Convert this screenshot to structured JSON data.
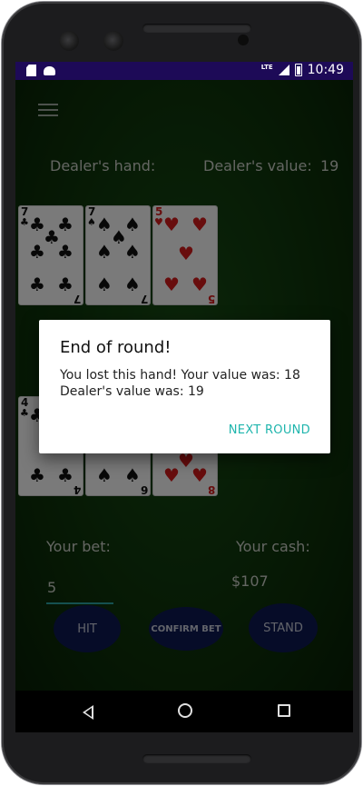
{
  "status_bar": {
    "network": "LTE",
    "time": "10:49"
  },
  "table": {
    "dealer_hand_label": "Dealer's hand:",
    "dealer_value_label": "Dealer's value:",
    "dealer_value": "19",
    "dealer_cards": [
      {
        "rank": "7",
        "suit": "♣"
      },
      {
        "rank": "7",
        "suit": "♠"
      },
      {
        "rank": "5",
        "suit": "♥"
      }
    ],
    "player_cards": [
      {
        "rank": "4",
        "suit": "♣"
      },
      {
        "rank": "6",
        "suit": "♠"
      },
      {
        "rank": "8",
        "suit": "♥"
      }
    ],
    "bet_label": "Your bet:",
    "bet_value": "5",
    "cash_label": "Your cash:",
    "cash_value": "$107",
    "hit_button": "HIT",
    "confirm_bet_button": "CONFIRM BET",
    "stand_button": "STAND"
  },
  "dialog": {
    "title": "End of round!",
    "message": "You lost this hand! Your value was: 18\nDealer's value was: 19",
    "next_button": "NEXT ROUND"
  },
  "colors": {
    "status_bar": "#1d0a57",
    "table_felt": "#174a14",
    "button": "#0c1850",
    "dialog_accent": "#1fb5ad"
  }
}
